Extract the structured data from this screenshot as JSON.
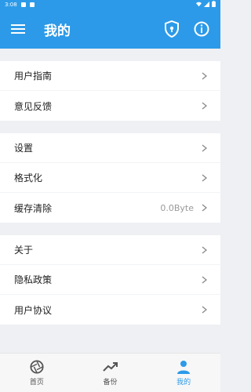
{
  "status_bar": {
    "time": "3:08"
  },
  "header": {
    "title": "我的"
  },
  "groups": [
    {
      "items": [
        {
          "label": "用户指南"
        },
        {
          "label": "意见反馈"
        }
      ]
    },
    {
      "items": [
        {
          "label": "设置"
        },
        {
          "label": "格式化"
        },
        {
          "label": "缓存清除",
          "value": "0.0Byte"
        }
      ]
    },
    {
      "items": [
        {
          "label": "关于"
        },
        {
          "label": "隐私政策"
        },
        {
          "label": "用户协议"
        }
      ]
    }
  ],
  "bottom_nav": [
    {
      "label": "首页",
      "icon": "camera-aperture-icon",
      "active": false
    },
    {
      "label": "备份",
      "icon": "trending-up-icon",
      "active": false
    },
    {
      "label": "我的",
      "icon": "person-icon",
      "active": true
    }
  ],
  "colors": {
    "primary": "#2c9ae8",
    "background": "#eef0f3"
  }
}
